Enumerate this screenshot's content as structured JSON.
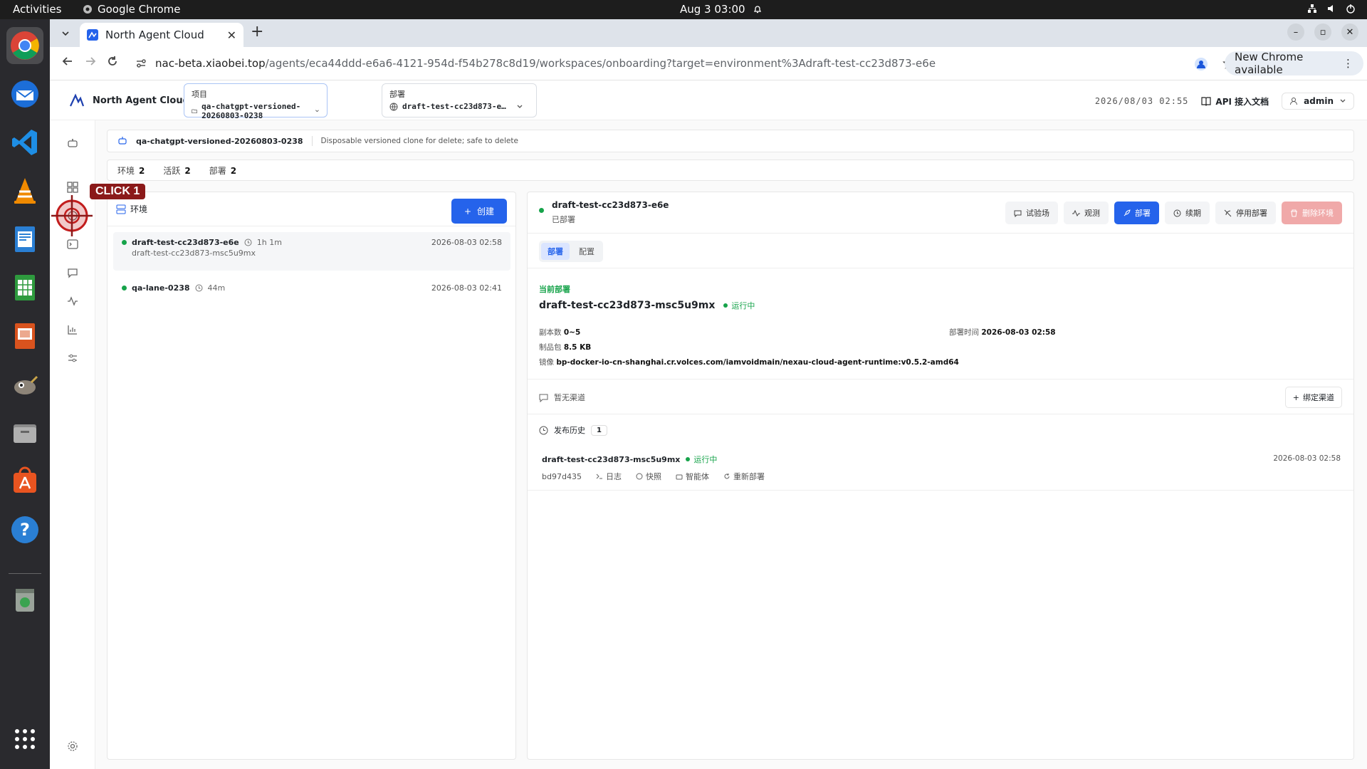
{
  "os": {
    "activities": "Activities",
    "app_name": "Google Chrome",
    "clock": "Aug 3  03:00"
  },
  "browser": {
    "tab_title": "North Agent Cloud",
    "url_host": "nac-beta.xiaobei.top",
    "url_path": "/agents/eca44ddd-e6a6-4121-954d-f54b278c8d19/workspaces/onboarding?target=environment%3Adraft-test-cc23d873-e6e",
    "new_chrome": "New Chrome available"
  },
  "header": {
    "brand": "North Agent Cloud",
    "project_label": "项目",
    "project_value": "qa-chatgpt-versioned-20260803-0238",
    "deploy_label": "部署",
    "deploy_value": "draft-test-cc23d873-e…",
    "time": "2026/08/03 02:55",
    "api_docs": "API 接入文档",
    "user": "admin"
  },
  "info": {
    "project": "qa-chatgpt-versioned-20260803-0238",
    "description": "Disposable versioned clone for delete; safe to delete"
  },
  "stats": [
    {
      "label": "环境",
      "value": "2"
    },
    {
      "label": "活跃",
      "value": "2"
    },
    {
      "label": "部署",
      "value": "2"
    }
  ],
  "env_panel": {
    "title": "环境",
    "create": "创建",
    "items": [
      {
        "name": "draft-test-cc23d873-e6e",
        "age": "1h 1m",
        "sub": "draft-test-cc23d873-msc5u9mx",
        "date": "2026-08-03 02:58"
      },
      {
        "name": "qa-lane-0238",
        "age": "44m",
        "sub": "",
        "date": "2026-08-03 02:41"
      }
    ]
  },
  "detail": {
    "name": "draft-test-cc23d873-e6e",
    "status": "已部署",
    "actions": [
      "试验场",
      "观测",
      "部署",
      "续期",
      "停用部署",
      "删除环境"
    ],
    "tabs": [
      "部署",
      "配置"
    ],
    "current_label": "当前部署",
    "deployment": "draft-test-cc23d873-msc5u9mx",
    "running": "运行中",
    "replicas_label": "副本数",
    "replicas": "0~5",
    "artifact_label": "制品包",
    "artifact": "8.5 KB",
    "image_label": "镜像",
    "image": "bp-docker-io-cn-shanghai.cr.volces.com/iamvoidmain/nexau-cloud-agent-runtime:v0.5.2-amd64",
    "deploy_time_label": "部署时间",
    "deploy_time": "2026-08-03 02:58",
    "no_channel": "暂无渠道",
    "bind_channel": "绑定渠道",
    "history_label": "发布历史",
    "history_count": "1",
    "history": {
      "name": "draft-test-cc23d873-msc5u9mx",
      "status": "运行中",
      "date": "2026-08-03 02:58",
      "hash": "bd97d435",
      "links": [
        "日志",
        "快照",
        "智能体",
        "重新部署"
      ]
    }
  },
  "overlay": {
    "click_label": "CLICK 1"
  },
  "colors": {
    "primary": "#2563eb",
    "success": "#16a34a",
    "danger_soft": "#f0a9a9"
  }
}
